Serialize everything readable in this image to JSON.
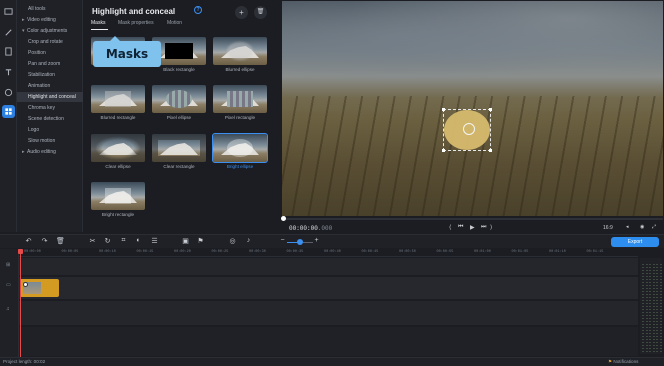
{
  "sidebar_tree": {
    "items": [
      {
        "label": "All tools",
        "group": false
      },
      {
        "label": "Video editing",
        "group": true,
        "arrow": "▸"
      },
      {
        "label": "Color adjustments",
        "group": true,
        "arrow": "▾"
      },
      {
        "label": "Crop and rotate",
        "group": false
      },
      {
        "label": "Position",
        "group": false
      },
      {
        "label": "Pan and zoom",
        "group": false
      },
      {
        "label": "Stabilization",
        "group": false
      },
      {
        "label": "Animation",
        "group": false
      },
      {
        "label": "Highlight and conceal",
        "group": false,
        "selected": true
      },
      {
        "label": "Chroma key",
        "group": false
      },
      {
        "label": "Scene detection",
        "group": false
      },
      {
        "label": "Logo",
        "group": false
      },
      {
        "label": "Slow motion",
        "group": false
      },
      {
        "label": "Audio editing",
        "group": true,
        "arrow": "▸"
      }
    ]
  },
  "panel": {
    "title": "Highlight and conceal",
    "help_icon": "?",
    "add_icon": "+",
    "delete_icon": "🗑",
    "tabs": [
      {
        "label": "Masks",
        "active": true
      },
      {
        "label": "Mask properties",
        "active": false
      },
      {
        "label": "Motion",
        "active": false
      }
    ],
    "callout": "Masks",
    "masks": [
      {
        "label": "",
        "mask": "none"
      },
      {
        "label": "Black rectangle",
        "mask": "black-rect"
      },
      {
        "label": "Blurred ellipse",
        "mask": "blur-ellipse"
      },
      {
        "label": "Blurred rectangle",
        "mask": "blur-rect"
      },
      {
        "label": "Pixel ellipse",
        "mask": "pixel-ellipse"
      },
      {
        "label": "Pixel rectangle",
        "mask": "pixel-rect"
      },
      {
        "label": "Clear ellipse",
        "mask": "clear-ellipse"
      },
      {
        "label": "Clear rectangle",
        "mask": "clear-rect"
      },
      {
        "label": "Bright ellipse",
        "mask": "bright-ellipse",
        "selected": true
      },
      {
        "label": "Bright rectangle",
        "mask": "bright-rect"
      }
    ]
  },
  "player": {
    "timecode": "00:00:00",
    "timecode_frac": ".000",
    "aspect": "16:9",
    "controls": [
      "⟨",
      "⏮",
      "▶",
      "⏭",
      "⟩"
    ]
  },
  "toolbar": {
    "export_label": "Export"
  },
  "timeline": {
    "ticks": [
      "00:00:00",
      "00:00:05",
      "00:00:10",
      "00:00:15",
      "00:00:20",
      "00:00:25",
      "00:00:30",
      "00:00:35",
      "00:00:40",
      "00:00:45",
      "00:00:50",
      "00:00:55",
      "00:01:00",
      "00:01:05",
      "00:01:10",
      "00:01:15"
    ]
  },
  "status": {
    "project_length": "Project length: 00:02",
    "notifications": "Notifications"
  },
  "colors": {
    "accent": "#2d8ef0",
    "callout": "#7fc2ee",
    "clip": "#d49b22",
    "playhead": "#e84a4a"
  }
}
